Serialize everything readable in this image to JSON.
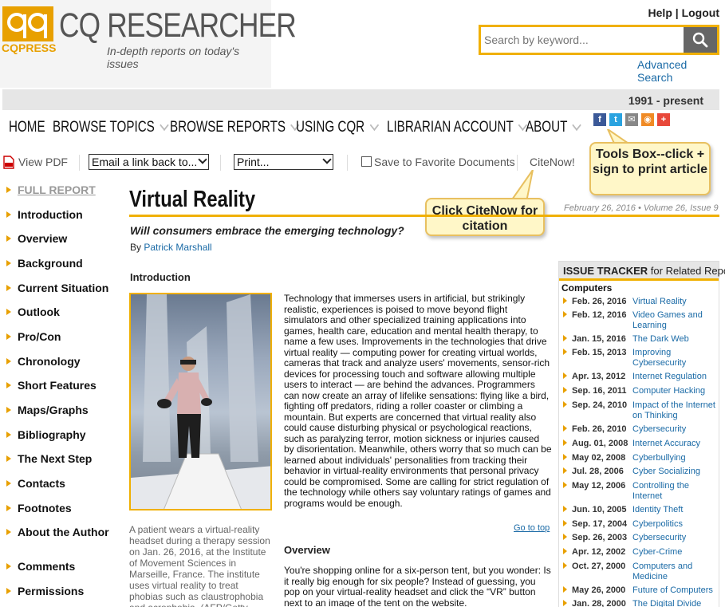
{
  "header": {
    "logo_press": "CQPRESS",
    "logo_title": "CQ RESEARCHER",
    "tagline": "In-depth reports on today's issues",
    "help": "Help",
    "sep": "|",
    "logout": "Logout",
    "search_placeholder": "Search by keyword...",
    "advanced_search": "Advanced Search",
    "date_range": "1991 - present"
  },
  "nav": {
    "items": [
      "HOME",
      "BROWSE TOPICS",
      "BROWSE REPORTS",
      "USING CQR",
      "LIBRARIAN ACCOUNT",
      "ABOUT"
    ]
  },
  "social": [
    "f",
    "t",
    "✉",
    "◉",
    "+"
  ],
  "toolbar": {
    "view_pdf": "View PDF",
    "email_select": "Email a link back to...",
    "print_select": "Print...",
    "save_fav": "Save to Favorite Documents",
    "citenow": "CiteNow!"
  },
  "callouts": {
    "tools": "Tools Box--click + sign to print article",
    "cite": "Click CiteNow for citation"
  },
  "sidebar": {
    "items": [
      "FULL REPORT",
      "Introduction",
      "Overview",
      "Background",
      "Current Situation",
      "Outlook",
      "Pro/Con",
      "Chronology",
      "Short Features",
      "Maps/Graphs",
      "Bibliography",
      "The Next Step",
      "Contacts",
      "Footnotes",
      "About the Author",
      "Comments",
      "Permissions"
    ]
  },
  "article": {
    "title": "Virtual Reality",
    "meta": "February 26, 2016 • Volume 26, Issue 9",
    "subtitle": "Will consumers embrace the emerging technology?",
    "by": "By",
    "author": "Patrick Marshall",
    "intro_heading": "Introduction",
    "caption": "A patient wears a virtual-reality headset during a therapy session on Jan. 26, 2016, at the Institute of Movement Sciences in Marseille, France. The institute uses virtual reality to treat phobias such as claustrophobia and acrophobia. (AFP/Getty",
    "intro": "Technology that immerses users in artificial, but strikingly realistic, experiences is poised to move beyond flight simulators and other specialized training applications into games, health care, education and mental health therapy, to name a few uses. Improvements in the technologies that drive virtual reality — computing power for creating virtual worlds, cameras that track and analyze users' movements, sensor-rich devices for processing touch and software allowing multiple users to interact — are behind the advances. Programmers can now create an array of lifelike sensations: flying like a bird, fighting off predators, riding a roller coaster or climbing a mountain. But experts are concerned that virtual reality also could cause disturbing physical or psychological reactions, such as paralyzing terror, motion sickness or injuries caused by disorientation. Meanwhile, others worry that so much can be learned about individuals' personalities from tracking their behavior in virtual-reality environments that personal privacy could be compromised. Some are calling for strict regulation of the technology while others say voluntary ratings of games and programs would be enough.",
    "goto_top": "Go to top",
    "overview_heading": "Overview",
    "overview": "You're shopping online for a six-person tent, but you wonder: Is it really big enough for six people? Instead of guessing, you pop on your virtual-reality headset and click the “VR” button next to an image of the tent on the website."
  },
  "tracker": {
    "head_bold": "ISSUE TRACKER",
    "head_rest": " for Related Reports",
    "category": "Computers",
    "rows": [
      {
        "date": "Feb. 26, 2016",
        "title": "Virtual Reality"
      },
      {
        "date": "Feb. 12, 2016",
        "title": "Video Games and Learning"
      },
      {
        "date": "Jan. 15, 2016",
        "title": "The Dark Web"
      },
      {
        "date": "Feb. 15, 2013",
        "title": "Improving Cybersecurity"
      },
      {
        "date": "Apr. 13, 2012",
        "title": "Internet Regulation"
      },
      {
        "date": "Sep. 16, 2011",
        "title": "Computer Hacking"
      },
      {
        "date": "Sep. 24, 2010",
        "title": "Impact of the Internet on Thinking"
      },
      {
        "date": "Feb. 26, 2010",
        "title": "Cybersecurity"
      },
      {
        "date": "Aug. 01, 2008",
        "title": "Internet Accuracy"
      },
      {
        "date": "May 02, 2008",
        "title": "Cyberbullying"
      },
      {
        "date": "Jul. 28, 2006",
        "title": "Cyber Socializing"
      },
      {
        "date": "May 12, 2006",
        "title": "Controlling the Internet"
      },
      {
        "date": "Jun. 10, 2005",
        "title": "Identity Theft"
      },
      {
        "date": "Sep. 17, 2004",
        "title": "Cyberpolitics"
      },
      {
        "date": "Sep. 26, 2003",
        "title": "Cybersecurity"
      },
      {
        "date": "Apr. 12, 2002",
        "title": "Cyber-Crime"
      },
      {
        "date": "Oct. 27, 2000",
        "title": "Computers and Medicine"
      },
      {
        "date": "May 26, 2000",
        "title": "Future of Computers"
      },
      {
        "date": "Jan. 28, 2000",
        "title": "The Digital Divide"
      }
    ]
  },
  "colors": {
    "accent": "#f0b000",
    "link": "#1a6aa6",
    "callout": "#fff7c8"
  }
}
